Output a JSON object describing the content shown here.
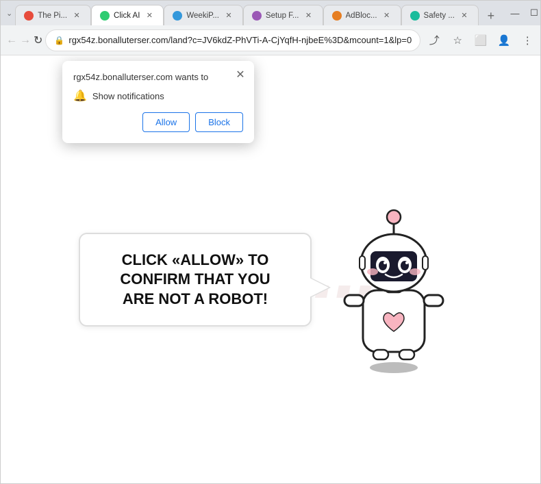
{
  "window": {
    "collapse_icon": "⌄",
    "minimize_icon": "—",
    "maximize_icon": "☐",
    "close_icon": "✕"
  },
  "tabs": [
    {
      "id": "tab-pirate",
      "label": "The Pi...",
      "favicon_class": "fav-pirate",
      "active": false,
      "close": "✕"
    },
    {
      "id": "tab-click",
      "label": "Click AI",
      "favicon_class": "fav-click",
      "active": true,
      "close": "✕"
    },
    {
      "id": "tab-wiki",
      "label": "WeekiP...",
      "favicon_class": "fav-wiki",
      "active": false,
      "close": "✕"
    },
    {
      "id": "tab-setup",
      "label": "Setup F...",
      "favicon_class": "fav-setup",
      "active": false,
      "close": "✕"
    },
    {
      "id": "tab-adblock",
      "label": "AdBloc...",
      "favicon_class": "fav-adblock",
      "active": false,
      "close": "✕"
    },
    {
      "id": "tab-safety",
      "label": "Safety ...",
      "favicon_class": "fav-safety",
      "active": false,
      "close": "✕"
    }
  ],
  "new_tab_icon": "+",
  "nav": {
    "back_icon": "←",
    "forward_icon": "→",
    "reload_icon": "↻",
    "address": "rgx54z.bonalluterser.com/land?c=JV6kdZ-PhVTi-A-CjYqfH-njbeE%3D&mcount=1&lp=0",
    "lock_icon": "🔒",
    "bookmark_icon": "☆",
    "extension_icon": "⬜",
    "account_icon": "👤",
    "menu_icon": "⋮",
    "share_icon": "⤴"
  },
  "notification_popup": {
    "title": "rgx54z.bonalluterser.com wants to",
    "close_icon": "✕",
    "bell_icon": "🔔",
    "notification_text": "Show notifications",
    "allow_label": "Allow",
    "block_label": "Block"
  },
  "page": {
    "watermark": "righ...",
    "bubble_text": "CLICK «ALLOW» TO CONFIRM THAT YOU ARE NOT A ROBOT!",
    "bubble_line1": "CLICK «ALLOW» TO CONFIRM THAT YOU",
    "bubble_line2": "ARE NOT A ROBOT!"
  },
  "colors": {
    "allow_btn": "#1a73e8",
    "block_btn": "#1a73e8",
    "bubble_border": "#dddddd",
    "accent": "#1a73e8"
  }
}
